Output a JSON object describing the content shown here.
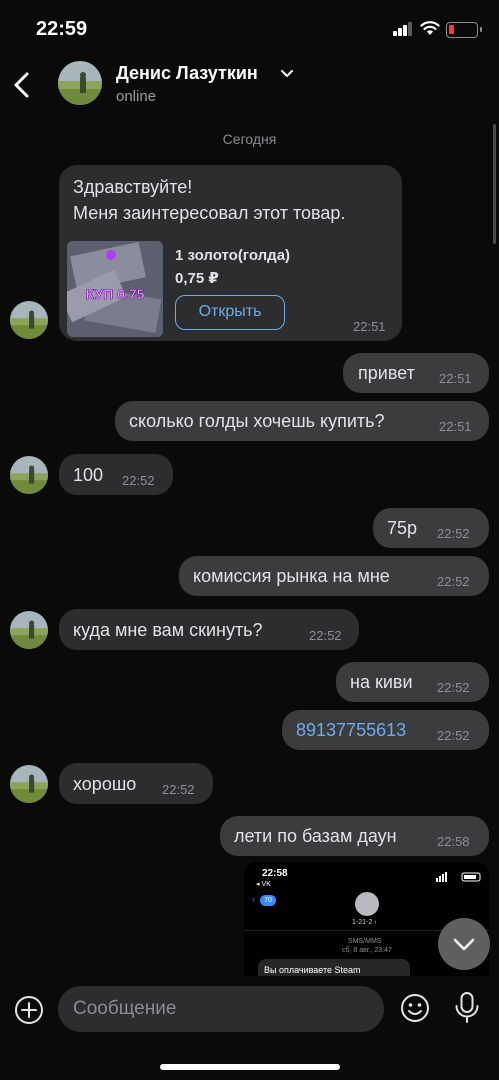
{
  "status_bar": {
    "time": "22:59"
  },
  "header": {
    "contact_name": "Денис Лазуткин",
    "status": "online"
  },
  "chat": {
    "date_separator": "Сегодня",
    "product_card": {
      "greeting": "Здравствуйте!",
      "line2": "Меня заинтересовал этот товар.",
      "image_text": "КУП 0.75",
      "title": "1 золото(голда)",
      "price": "0,75 ₽",
      "open_button": "Открыть",
      "time": "22:51"
    },
    "messages": [
      {
        "dir": "out",
        "text": "привет",
        "time": "22:51"
      },
      {
        "dir": "out",
        "text": "сколько голды хочешь купить?",
        "time": "22:51"
      },
      {
        "dir": "in",
        "text": "100",
        "time": "22:52"
      },
      {
        "dir": "out",
        "text": "75р",
        "time": "22:52"
      },
      {
        "dir": "out",
        "text": "комиссия рынка на мне",
        "time": "22:52"
      },
      {
        "dir": "in",
        "text": "куда мне вам скинуть?",
        "time": "22:52"
      },
      {
        "dir": "out",
        "text": "на киви",
        "time": "22:52"
      },
      {
        "dir": "out",
        "text": "89137755613",
        "time": "22:52"
      },
      {
        "dir": "in",
        "text": "хорошо",
        "time": "22:52"
      },
      {
        "dir": "out",
        "text": "лети по базам даун",
        "time": "22:58"
      }
    ],
    "attachment_screenshot": {
      "time": "22:58",
      "back_label": "◂ VK",
      "badge": "70",
      "contact": "1-21-2 ›",
      "sms_label": "SMS/MMS",
      "date": "сб, 8 авг., 23:47",
      "message": "Вы оплачиваете Steam"
    }
  },
  "composer": {
    "placeholder": "Сообщение"
  },
  "colors": {
    "background": "#0a0a0a",
    "bubble_in": "#2c2d2e",
    "bubble_out": "#3b3c3e",
    "accent": "#71aaeb"
  }
}
